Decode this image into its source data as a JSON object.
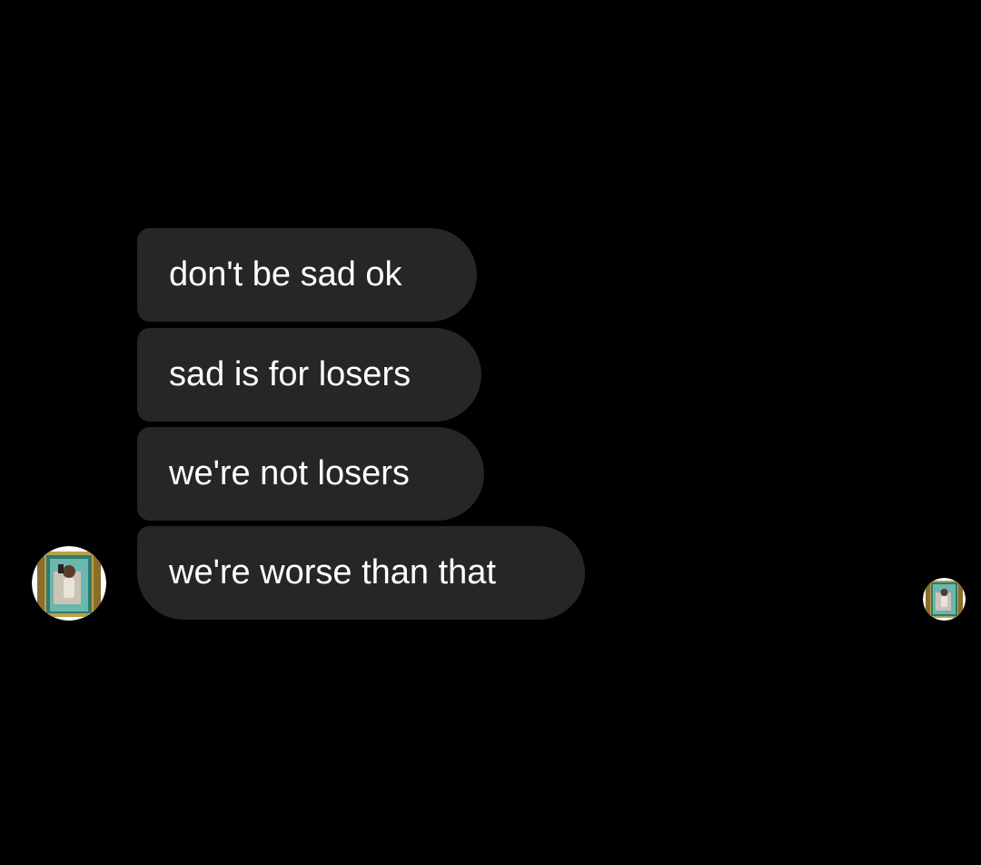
{
  "messages": [
    {
      "text": "don't be sad ok"
    },
    {
      "text": "sad is for losers"
    },
    {
      "text": "we're not losers"
    },
    {
      "text": "we're worse than that"
    }
  ],
  "colors": {
    "background": "#000000",
    "bubble": "#262626",
    "text": "#ffffff"
  },
  "icons": {
    "sender_avatar": "profile-photo-avatar",
    "seen_indicator": "seen-avatar-icon"
  }
}
